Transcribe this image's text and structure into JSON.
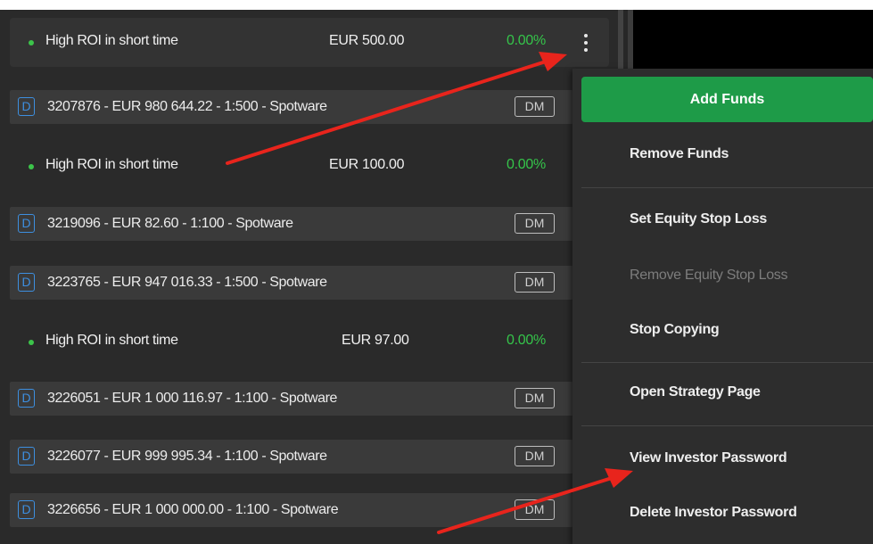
{
  "strategies": [
    {
      "name": "High ROI in short time",
      "amount": "EUR 500.00",
      "change": "0.00%"
    },
    {
      "name": "High ROI in short time",
      "amount": "EUR 100.00",
      "change": "0.00%"
    },
    {
      "name": "High ROI in short time",
      "amount": "EUR 97.00",
      "change": "0.00%"
    }
  ],
  "accounts": [
    {
      "badge": "D",
      "label": "3207876 - EUR 980 644.22 - 1:500 - Spotware",
      "tag": "DM"
    },
    {
      "badge": "D",
      "label": "3219096 - EUR 82.60 - 1:100 - Spotware",
      "tag": "DM"
    },
    {
      "badge": "D",
      "label": "3223765 - EUR 947 016.33 - 1:500 - Spotware",
      "tag": "DM"
    },
    {
      "badge": "D",
      "label": "3226051 - EUR 1 000 116.97 - 1:100 - Spotware",
      "tag": "DM"
    },
    {
      "badge": "D",
      "label": "3226077 - EUR 999 995.34 - 1:100 - Spotware",
      "tag": "DM"
    },
    {
      "badge": "D",
      "label": "3226656 - EUR 1 000 000.00 - 1:100 - Spotware",
      "tag": "DM"
    }
  ],
  "menu": {
    "add_funds": "Add Funds",
    "remove_funds": "Remove Funds",
    "set_equity_stop_loss": "Set Equity Stop Loss",
    "remove_equity_stop_loss": "Remove Equity Stop Loss",
    "stop_copying": "Stop Copying",
    "open_strategy_page": "Open Strategy Page",
    "view_investor_password": "View Investor Password",
    "delete_investor_password": "Delete Investor Password"
  },
  "colors": {
    "positive": "#35c44a",
    "accent_green": "#1e9b48",
    "badge_blue": "#3d8fe0",
    "annotation_arrow": "#e8241c"
  },
  "icons": {
    "more_options": "kebab-vertical-icon",
    "status": "status-dot-icon"
  }
}
